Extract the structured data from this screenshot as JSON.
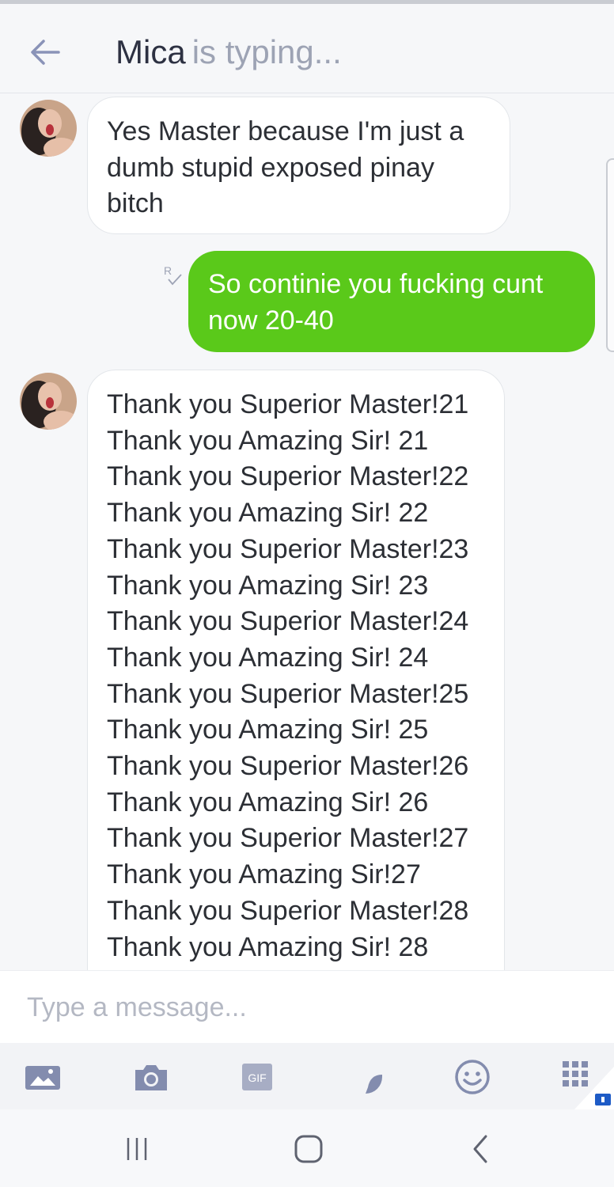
{
  "header": {
    "contact_name": "Mica",
    "status": "is typing..."
  },
  "messages": [
    {
      "direction": "incoming",
      "lines": [
        "Yes Master because I'm just a",
        "dumb stupid exposed pinay",
        "bitch"
      ]
    },
    {
      "direction": "outgoing",
      "receipt": "R",
      "lines": [
        "So continie you fucking cunt",
        "now 20-40"
      ]
    },
    {
      "direction": "incoming",
      "lines": [
        "Thank you Superior Master!21",
        "Thank you Amazing Sir! 21",
        "Thank you Superior Master!22",
        "Thank you Amazing Sir! 22",
        "Thank you Superior Master!23",
        "Thank you Amazing Sir! 23",
        "Thank you Superior Master!24",
        "Thank you Amazing Sir! 24",
        "Thank you Superior Master!25",
        "Thank you Amazing Sir! 25",
        "Thank you Superior Master!26",
        "Thank you Amazing Sir! 26",
        "Thank you Superior Master!27",
        "Thank you Amazing Sir!27",
        "Thank you Superior Master!28",
        "Thank you Amazing Sir! 28"
      ]
    }
  ],
  "composer": {
    "placeholder": "Type a message...",
    "tools": [
      "gallery-icon",
      "camera-icon",
      "gif-icon",
      "sticker-icon",
      "emoji-icon",
      "apps-grid-icon"
    ],
    "gif_label": "GIF"
  },
  "colors": {
    "outgoing_bubble": "#5ac91a",
    "incoming_bubble": "#ffffff",
    "accent": "#7f8bb3"
  }
}
